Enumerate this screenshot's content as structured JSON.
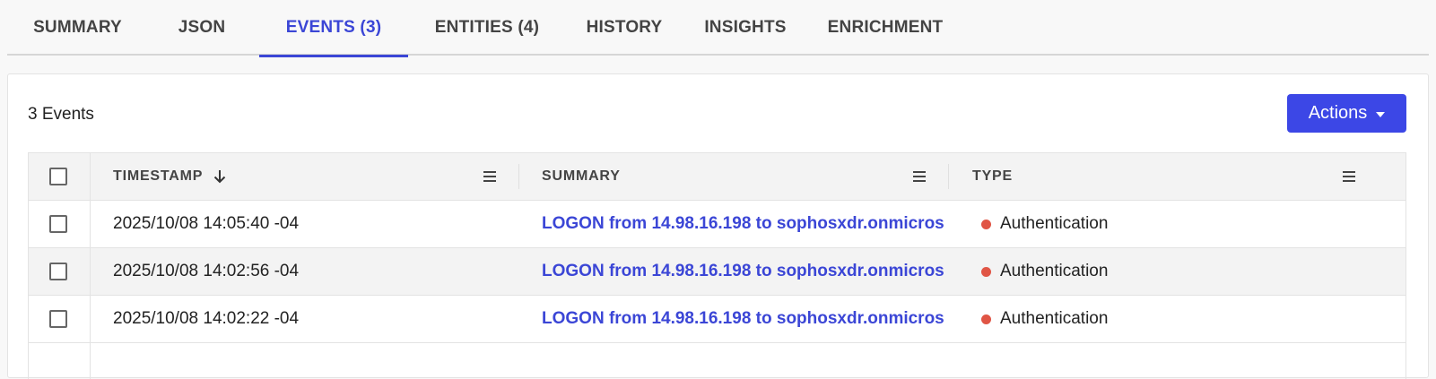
{
  "tabs": [
    {
      "label": "SUMMARY"
    },
    {
      "label": "JSON"
    },
    {
      "label": "EVENTS (3)"
    },
    {
      "label": "ENTITIES (4)"
    },
    {
      "label": "HISTORY"
    },
    {
      "label": "INSIGHTS"
    },
    {
      "label": "ENRICHMENT"
    }
  ],
  "active_tab": "EVENTS (3)",
  "panel": {
    "count_label": "3 Events",
    "actions_label": "Actions"
  },
  "table": {
    "headers": {
      "timestamp": "TIMESTAMP",
      "summary": "SUMMARY",
      "type": "TYPE"
    },
    "sort": {
      "column": "TIMESTAMP",
      "direction": "descending",
      "icon": "arrow-down-icon"
    },
    "rows": [
      {
        "timestamp": "2025/10/08 14:05:40 -04",
        "summary": "LOGON from 14.98.16.198 to sophosxdr.onmicros",
        "type": "Authentication"
      },
      {
        "timestamp": "2025/10/08 14:02:56 -04",
        "summary": "LOGON from 14.98.16.198 to sophosxdr.onmicros",
        "type": "Authentication"
      },
      {
        "timestamp": "2025/10/08 14:02:22 -04",
        "summary": "LOGON from 14.98.16.198 to sophosxdr.onmicros",
        "type": "Authentication"
      }
    ]
  },
  "colors": {
    "accent": "#3b46d6",
    "button": "#3c47e6",
    "type_dot": "#e05545"
  }
}
